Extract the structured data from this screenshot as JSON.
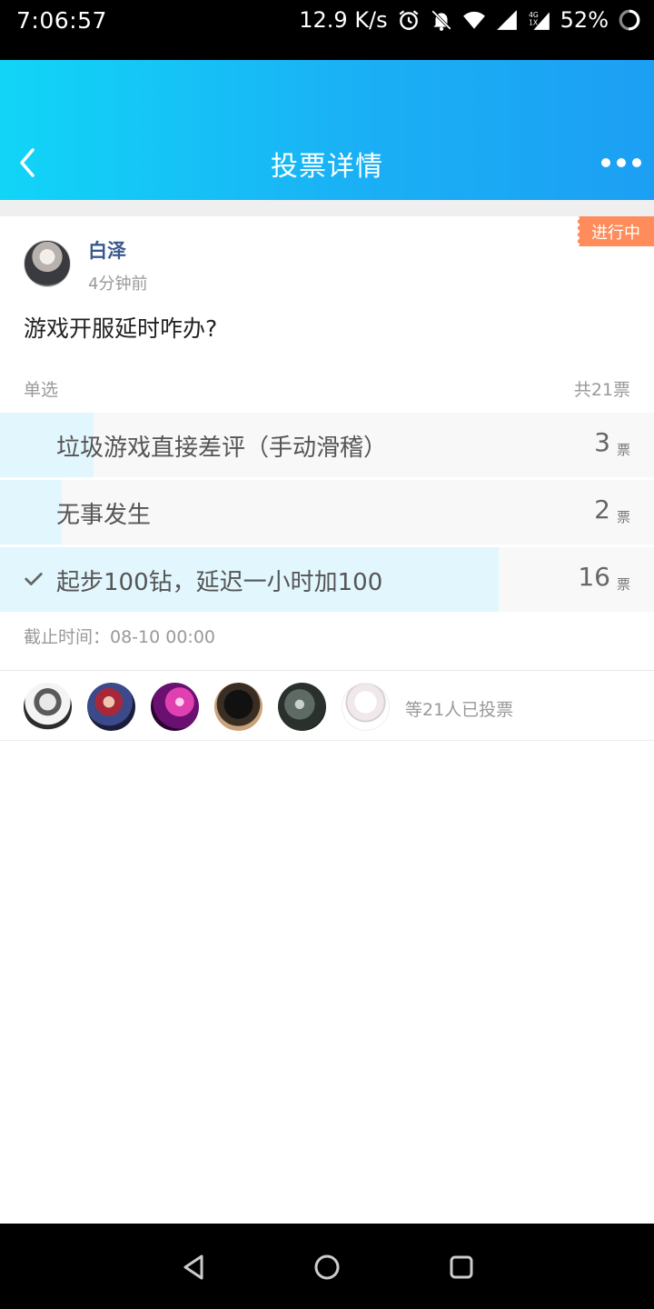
{
  "status_bar": {
    "time": "7:06:57",
    "net_speed": "12.9 K/s",
    "battery": "52%",
    "icons": [
      "alarm-icon",
      "bell-off-icon",
      "wifi-icon",
      "signal-icon",
      "signal-4g-icon",
      "battery-icon"
    ]
  },
  "header": {
    "title": "投票详情",
    "back_icon": "chevron-left-icon",
    "more_icon": "more-dots-icon",
    "gradient": [
      "#11d5f7",
      "#1c9ff3"
    ]
  },
  "poll": {
    "status_tag": "进行中",
    "author": "白泽",
    "time_ago": "4分钟前",
    "question": "游戏开服延时咋办?",
    "type": "单选",
    "total": "共21票",
    "options": [
      {
        "label": "垃圾游戏直接差评（手动滑稽）",
        "count": "3",
        "unit": "票",
        "share": 0.143,
        "selected": false
      },
      {
        "label": "无事发生",
        "count": "2",
        "unit": "票",
        "share": 0.095,
        "selected": false
      },
      {
        "label": "起步100钻，延迟一小时加100",
        "count": "16",
        "unit": "票",
        "share": 0.762,
        "selected": true
      }
    ],
    "deadline": "截止时间：08-10 00:00"
  },
  "voters": {
    "summary": "等21人已投票",
    "avatars": [
      "avatar-girl-sketch",
      "avatar-fantasy",
      "avatar-pink",
      "avatar-cat",
      "avatar-dark-art",
      "avatar-anime-girl"
    ]
  },
  "colors": {
    "accent": "#1ab0f5",
    "fill": "#e2f6fd",
    "tag": "#ff8c5a",
    "author": "#3a5a8c"
  },
  "nav_bar": {
    "icons": [
      "back-triangle-icon",
      "home-circle-icon",
      "recents-square-icon"
    ]
  }
}
